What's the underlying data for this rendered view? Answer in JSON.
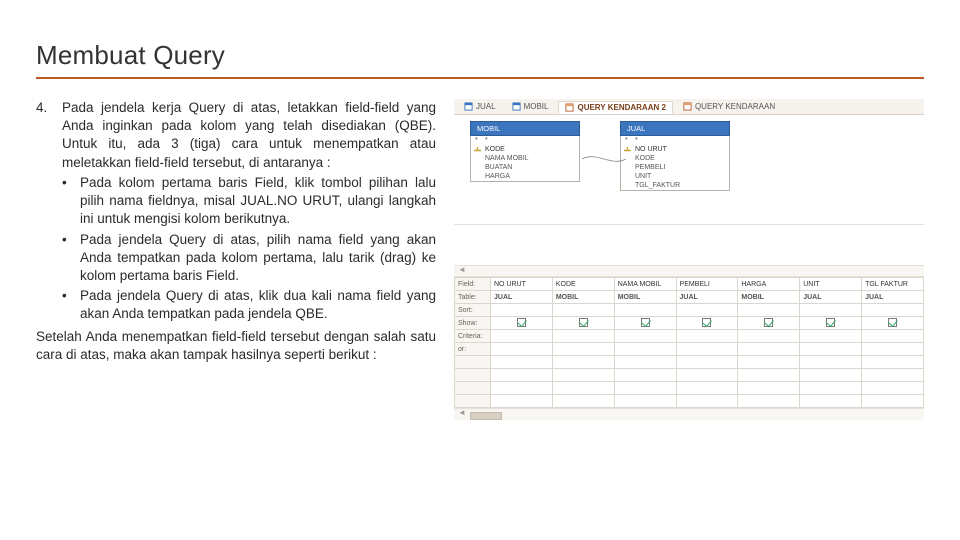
{
  "title": "Membuat Query",
  "step": {
    "num": "4.",
    "intro1": "Pada jendela kerja Query di atas, letakkan field-field yang Anda inginkan pada kolom yang telah disediakan (QBE). Untuk itu, ada 3 (tiga) cara untuk menempatkan atau meletakkan field-field tersebut, di antaranya :",
    "s1": "Pada kolom pertama baris Field, klik tombol pilihan lalu pilih nama fieldnya, misal JUAL.NO URUT, ulangi langkah ini untuk mengisi kolom berikutnya.",
    "s2": "Pada jendela Query di atas, pilih nama field yang akan Anda tempatkan pada kolom pertama, lalu tarik (drag) ke kolom pertama baris Field.",
    "s3": "Pada jendela Query di atas, klik dua kali nama field yang akan Anda tempatkan pada jendela QBE.",
    "closer": "Setelah Anda menempatkan field-field tersebut dengan salah satu cara di atas, maka akan tampak hasilnya seperti berikut :"
  },
  "access": {
    "tabs": [
      "JUAL",
      "MOBIL",
      "QUERY KENDARAAN 2",
      "QUERY KENDARAAN"
    ],
    "active": 2,
    "table1": {
      "name": "MOBIL",
      "rows": [
        "*",
        "KODE",
        "NAMA MOBIL",
        "BUATAN",
        "HARGA"
      ],
      "keyIndex": 1
    },
    "table2": {
      "name": "JUAL",
      "rows": [
        "*",
        "NO URUT",
        "KODE",
        "PEMBELI",
        "UNIT",
        "TGL_FAKTUR"
      ],
      "keyIndex": 1
    },
    "gridLabels": {
      "field": "Field:",
      "table": "Table:",
      "sort": "Sort:",
      "show": "Show:",
      "criteria": "Criteria:",
      "or": "or:"
    },
    "columns": [
      {
        "field": "NO URUT",
        "table": "JUAL"
      },
      {
        "field": "KODE",
        "table": "MOBIL"
      },
      {
        "field": "NAMA MOBIL",
        "table": "MOBIL"
      },
      {
        "field": "PEMBELI",
        "table": "JUAL"
      },
      {
        "field": "HARGA",
        "table": "MOBIL"
      },
      {
        "field": "UNIT",
        "table": "JUAL"
      },
      {
        "field": "TGL FAKTUR",
        "table": "JUAL"
      }
    ]
  }
}
